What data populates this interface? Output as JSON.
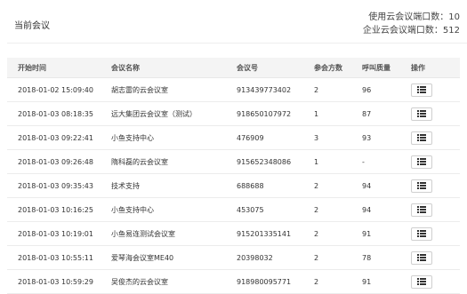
{
  "header": {
    "title": "当前会议",
    "stats_line1": "使用云会议端口数：10",
    "stats_line2": "企业云会议端口数：512"
  },
  "table": {
    "columns": [
      "开始时间",
      "会议名称",
      "会议号",
      "参会方数",
      "呼叫质量",
      "操作"
    ],
    "rows": [
      {
        "start": "2018-01-02 15:09:40",
        "name": "胡志雷的云会议室",
        "number": "913439773402",
        "participants": "2",
        "quality": "96"
      },
      {
        "start": "2018-01-03 08:18:35",
        "name": "远大集团云会议室（测试）",
        "number": "918650107972",
        "participants": "1",
        "quality": "87"
      },
      {
        "start": "2018-01-03 09:22:41",
        "name": "小鱼支持中心",
        "number": "476909",
        "participants": "3",
        "quality": "93"
      },
      {
        "start": "2018-01-03 09:26:48",
        "name": "隋科磊的云会议室",
        "number": "915652348086",
        "participants": "1",
        "quality": "-"
      },
      {
        "start": "2018-01-03 09:35:43",
        "name": "技术支持",
        "number": "688688",
        "participants": "2",
        "quality": "94"
      },
      {
        "start": "2018-01-03 10:16:25",
        "name": "小鱼支持中心",
        "number": "453075",
        "participants": "2",
        "quality": "94"
      },
      {
        "start": "2018-01-03 10:19:01",
        "name": "小鱼易连测试会议室",
        "number": "915201335141",
        "participants": "2",
        "quality": "91"
      },
      {
        "start": "2018-01-03 10:55:11",
        "name": "爱琴海会议室ME40",
        "number": "20398032",
        "participants": "2",
        "quality": "78"
      },
      {
        "start": "2018-01-03 10:59:29",
        "name": "吴俊杰的云会议室",
        "number": "918980095771",
        "participants": "2",
        "quality": "91"
      }
    ],
    "action_icon": "list-icon"
  }
}
